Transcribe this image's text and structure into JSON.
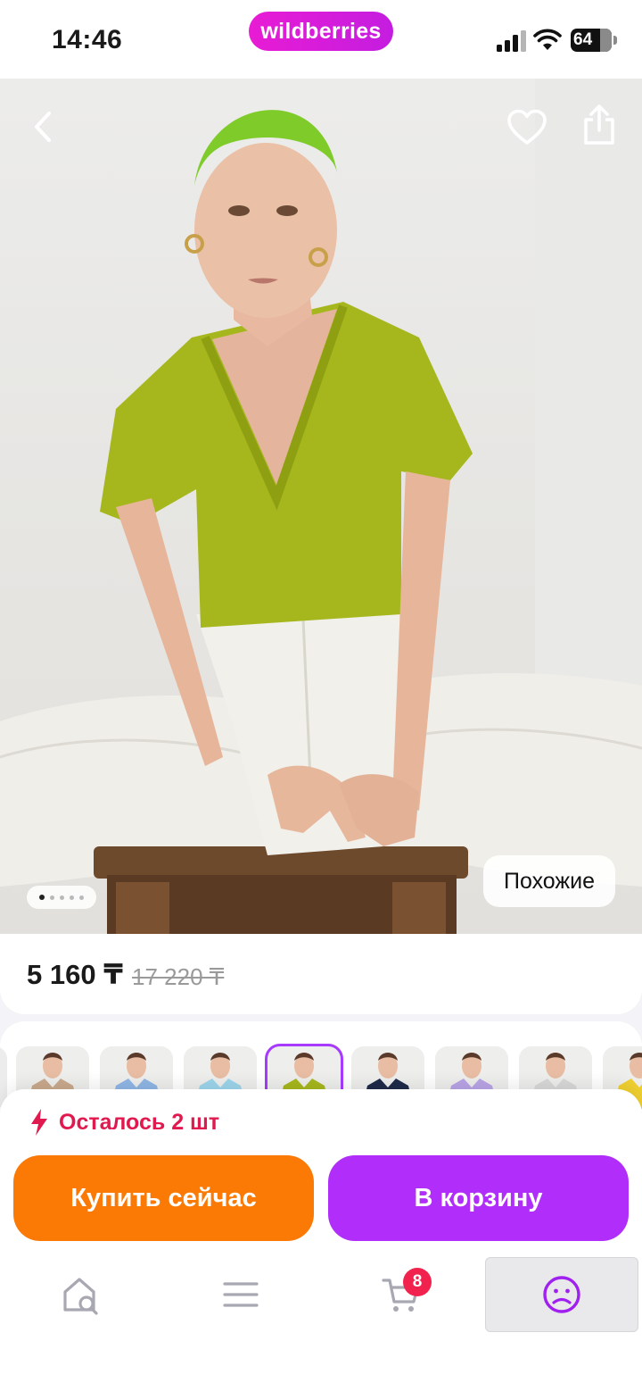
{
  "status_bar": {
    "time": "14:46",
    "brand": "wildberries",
    "battery": "64"
  },
  "hero": {
    "image": "model-lime-green-vneck-tshirt-white-jeans",
    "back_icon": "chevron-left-icon",
    "favorite_icon": "heart-icon",
    "share_icon": "share-icon",
    "similar_label": "Похожие",
    "photo_count": 5,
    "active_photo": 1
  },
  "price": {
    "current": "5 160 ₸",
    "old": "17 220 ₸"
  },
  "variants": {
    "selected_index": 3,
    "colors": [
      {
        "shirt": "#c9a98c"
      },
      {
        "shirt": "#8fb6e6"
      },
      {
        "shirt": "#9dd5ec"
      },
      {
        "shirt": "#a6b71d"
      },
      {
        "shirt": "#1f2a4a"
      },
      {
        "shirt": "#b9a4e6"
      },
      {
        "shirt": "#d8d8d8"
      },
      {
        "shirt": "#f0d030"
      }
    ]
  },
  "stock": {
    "text": "Осталось 2 шт",
    "icon": "lightning-icon",
    "color": "#e01a4f"
  },
  "actions": {
    "buy_now": "Купить сейчас",
    "add_to_cart": "В корзину",
    "buy_color": "#fb7a06",
    "cart_color": "#b12dfa"
  },
  "tabbar": {
    "items": [
      {
        "name": "home-search",
        "icon": "home-search-icon"
      },
      {
        "name": "catalog",
        "icon": "menu-icon"
      },
      {
        "name": "cart",
        "icon": "cart-icon"
      },
      {
        "name": "profile",
        "icon": "profile-icon"
      }
    ],
    "cart_badge": "8",
    "active": "profile"
  }
}
